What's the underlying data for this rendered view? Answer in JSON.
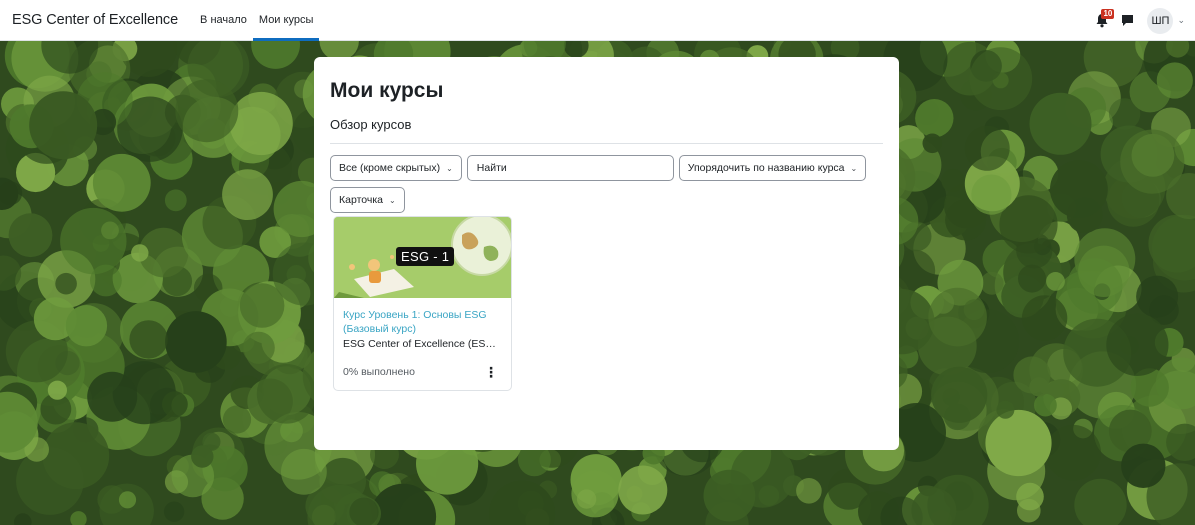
{
  "navbar": {
    "brand": "ESG Center of Excellence",
    "links": [
      {
        "label": "В начало",
        "active": false
      },
      {
        "label": "Мои курсы",
        "active": true
      }
    ],
    "notification_count": "10",
    "user_initials": "ШП",
    "icons": [
      "bell-icon",
      "chat-icon",
      "chevron-down-icon"
    ]
  },
  "main": {
    "page_title": "Мои курсы",
    "section_title": "Обзор курсов",
    "filters": {
      "grouping": "Все (кроме скрытых)",
      "search_placeholder": "Найти",
      "sort": "Упорядочить по названию курса",
      "view": "Карточка"
    },
    "courses": [
      {
        "image_label": "ESG - 1",
        "name": "Курс Уровень 1: Основы ESG (Базовый курс)",
        "category": "ESG Center of Excellence (ESG ...",
        "progress": "0% выполнено",
        "progress_value": 0
      }
    ]
  },
  "colors": {
    "accent": "#0f6cbf",
    "course_link": "#3aa5c4",
    "badge": "#ca3120",
    "course_image_bg": "#a6cc6a"
  }
}
